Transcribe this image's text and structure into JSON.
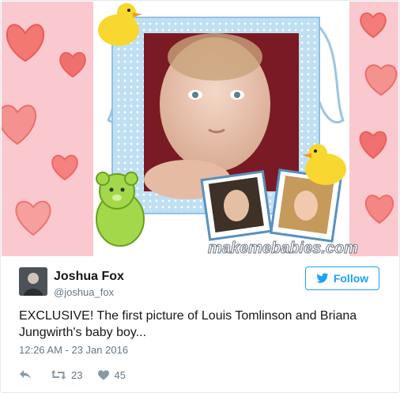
{
  "media": {
    "watermark": "makemebabies.com"
  },
  "tweet": {
    "author_name": "Joshua Fox",
    "author_handle": "@joshua_fox",
    "follow_label": "Follow",
    "text": "EXCLUSIVE! The first picture of Louis Tomlinson and Briana Jungwirth's baby boy...",
    "timestamp": "12:26 AM - 23 Jan 2016",
    "retweet_count": "23",
    "like_count": "45"
  },
  "colors": {
    "accent": "#1da1f2",
    "muted": "#657786",
    "text": "#14171a"
  },
  "icons": [
    "reply-icon",
    "retweet-icon",
    "heart-icon",
    "twitter-bird-icon"
  ]
}
